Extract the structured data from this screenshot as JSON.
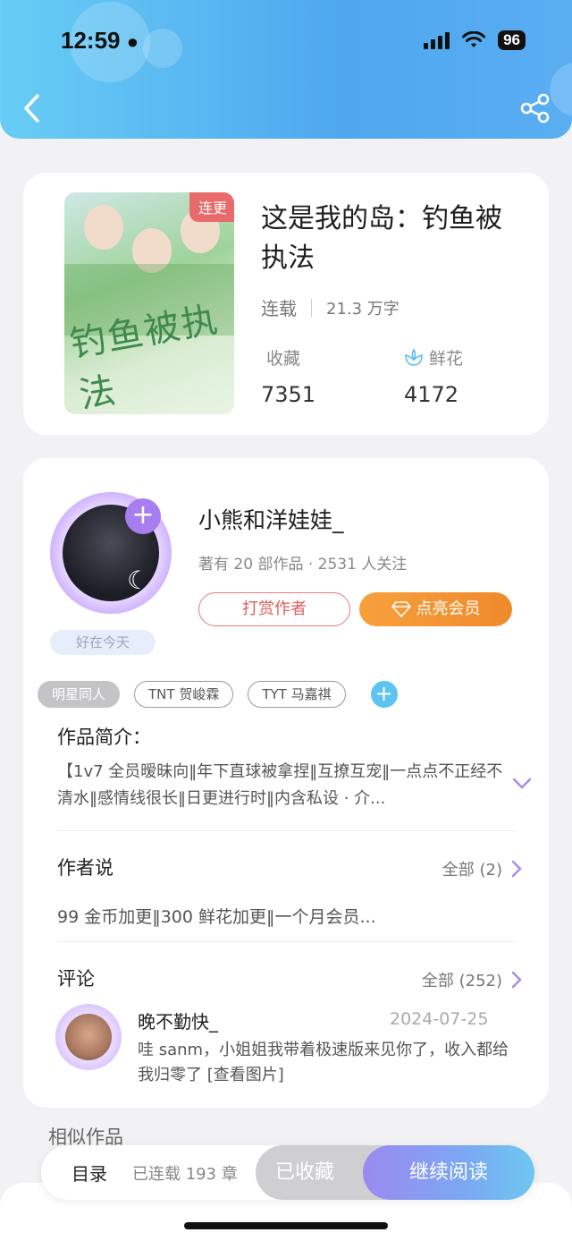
{
  "status": {
    "time": "12:59",
    "battery": "96"
  },
  "book": {
    "title": "这是我的岛：钓鱼被执法",
    "cover_tag": "连更",
    "cover_text": "钓鱼被执法",
    "status": "连载",
    "words": "21.3 万字",
    "favorites_label": "收藏",
    "favorites": "7351",
    "flowers_label": "鲜花",
    "flowers": "4172"
  },
  "author": {
    "name": "小熊和洋娃娃_",
    "stats": "著有 20 部作品 · 2531 人关注",
    "mood": "好在今天",
    "tip_button": "打赏作者",
    "vip_button": "点亮会员"
  },
  "tags": [
    "明星同人",
    "TNT 贺峻霖",
    "TYT 马嘉祺"
  ],
  "intro": {
    "heading": "作品简介：",
    "text": "【1v7 全员暧昧向‖年下直球被拿捏‖互撩互宠‖一点点不正经不清水‖感情线很长‖日更进行时‖内含私设 · 介..."
  },
  "author_say": {
    "heading": "作者说",
    "more": "全部 (2)",
    "text": "99 金币加更‖300 鲜花加更‖一个月会员..."
  },
  "comments": {
    "heading": "评论",
    "more": "全部 (252)",
    "items": [
      {
        "user": "晚不勤快_",
        "date": "2024-07-25",
        "text": "哇 sanm，小姐姐我带着极速版来见你了，收入都给我归零了 [查看图片]"
      }
    ]
  },
  "similar_heading": "相似作品",
  "bottom": {
    "toc": "目录",
    "chapters": "已连载 193 章",
    "favorited": "已收藏",
    "continue": "继续阅读"
  },
  "colors": {
    "accent": "#4fa7ef",
    "purple": "#a67ef0",
    "orange": "#f08a2c",
    "red": "#e25d5d"
  }
}
